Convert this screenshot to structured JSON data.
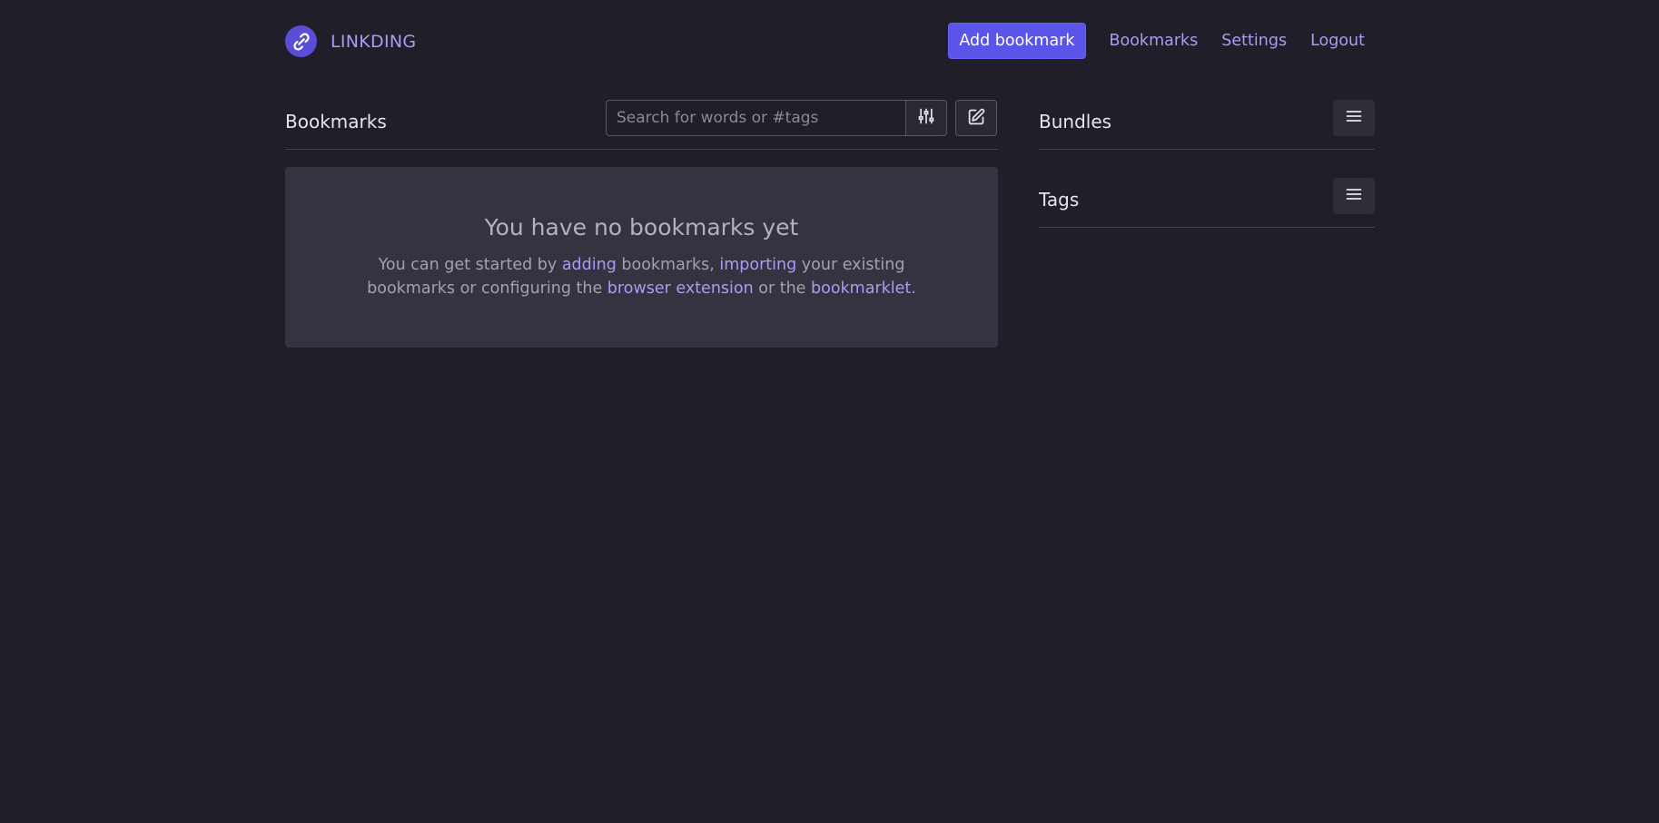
{
  "header": {
    "brand": "LINKDING",
    "add_bookmark_label": "Add bookmark",
    "nav": {
      "bookmarks": "Bookmarks",
      "settings": "Settings",
      "logout": "Logout"
    }
  },
  "main": {
    "title": "Bookmarks",
    "search": {
      "value": "",
      "placeholder": "Search for words or #tags"
    },
    "empty_state": {
      "title": "You have no bookmarks yet",
      "text_1": "You can get started by ",
      "link_adding": "adding",
      "text_2": " bookmarks, ",
      "link_importing": "importing",
      "text_3": " your existing bookmarks or configuring the ",
      "link_extension": "browser extension",
      "text_4": " or the ",
      "link_bookmarklet": "bookmarklet",
      "text_5": "."
    }
  },
  "side": {
    "bundles_title": "Bundles",
    "tags_title": "Tags"
  },
  "icons": {
    "logo": "paperclip-link-icon",
    "filter": "sliders-icon",
    "edit": "pencil-square-icon",
    "menu": "hamburger-menu-icon"
  },
  "colors": {
    "background": "#201e28",
    "accent": "#5b54e8",
    "link": "#a99cf5",
    "card": "#35333f"
  }
}
